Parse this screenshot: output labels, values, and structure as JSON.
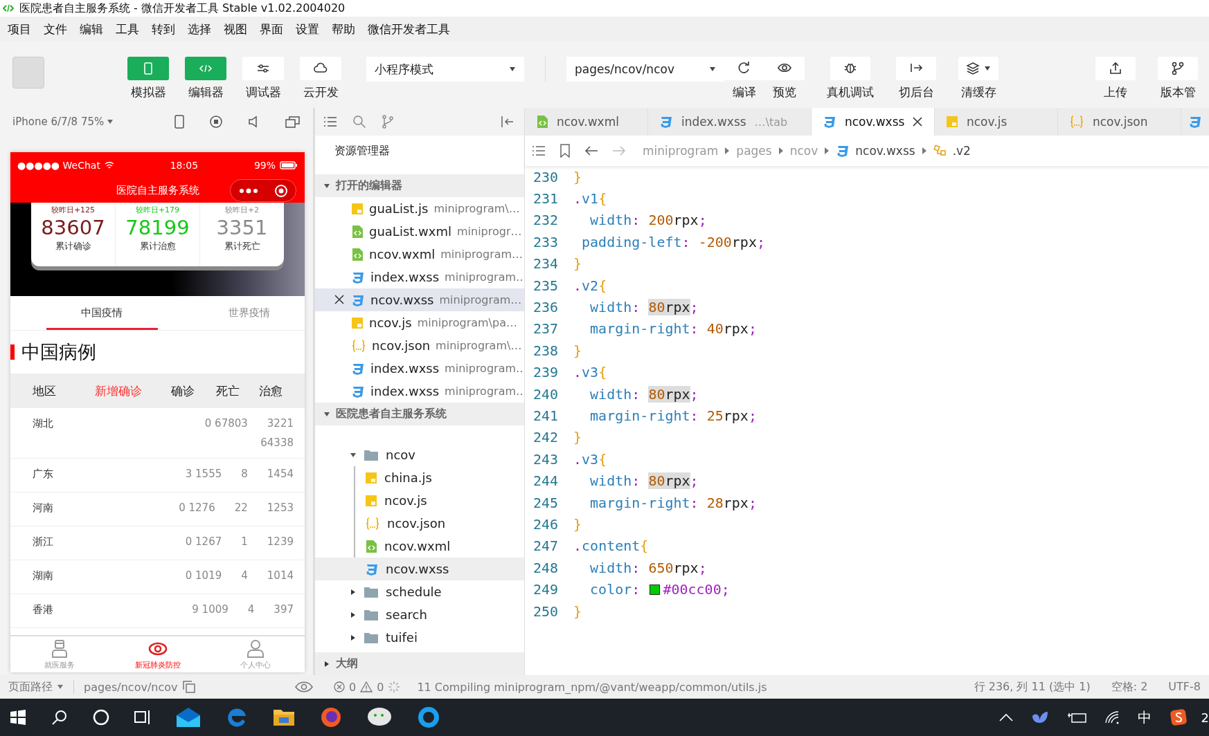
{
  "window": {
    "title": "医院患者自主服务系统 - 微信开发者工具 Stable v1.02.2004020"
  },
  "menu": [
    "项目",
    "文件",
    "编辑",
    "工具",
    "转到",
    "选择",
    "视图",
    "界面",
    "设置",
    "帮助",
    "微信开发者工具"
  ],
  "toolbar": {
    "mode_buttons": [
      {
        "label": "模拟器",
        "on": true
      },
      {
        "label": "编辑器",
        "on": true
      },
      {
        "label": "调试器",
        "on": false
      },
      {
        "label": "云开发",
        "on": false
      }
    ],
    "mode_select": "小程序模式",
    "page_select": "pages/ncov/ncov",
    "actions": [
      "编译",
      "预览",
      "真机调试",
      "切后台",
      "清缓存",
      "上传",
      "版本管"
    ]
  },
  "simulator": {
    "device": "iPhone 6/7/8 75%",
    "phone": {
      "carrier": "●●●●● WeChat",
      "time": "18:05",
      "battery": "99%",
      "nav_title": "医院自主服务系统",
      "stats": [
        {
          "delta": "较昨日+125",
          "value": "83607",
          "label": "累计确诊",
          "color": "#7a1a1a"
        },
        {
          "delta": "较昨日+179",
          "value": "78199",
          "label": "累计治愈",
          "color": "#16c816"
        },
        {
          "delta": "较昨日+2",
          "value": "3351",
          "label": "累计死亡",
          "color": "#8a8a8a"
        }
      ],
      "tabs": [
        {
          "label": "中国疫情",
          "selected": true
        },
        {
          "label": "世界疫情",
          "selected": false
        }
      ],
      "section_title": "中国病例",
      "columns": [
        {
          "label": "地区",
          "highlighted": false
        },
        {
          "label": "新增确诊",
          "highlighted": true
        },
        {
          "label": "确诊",
          "highlighted": false
        },
        {
          "label": "死亡",
          "highlighted": false
        },
        {
          "label": "治愈",
          "highlighted": false
        }
      ],
      "rows": [
        {
          "region": "湖北",
          "values": [
            "0 67803",
            "3221",
            "64338"
          ]
        },
        {
          "region": "广东",
          "values": [
            "3 1555",
            "8",
            "1454"
          ]
        },
        {
          "region": "河南",
          "values": [
            "0 1276",
            "22",
            "1253"
          ]
        },
        {
          "region": "浙江",
          "values": [
            "0 1267",
            "1",
            "1239"
          ]
        },
        {
          "region": "湖南",
          "values": [
            "0 1019",
            "4",
            "1014"
          ]
        },
        {
          "region": "香港",
          "values": [
            "9 1009",
            "4",
            "397"
          ]
        }
      ],
      "bottom_tabs": [
        {
          "label": "就医服务",
          "selected": false
        },
        {
          "label": "新冠肺炎防控",
          "selected": true
        },
        {
          "label": "个人中心",
          "selected": false
        }
      ]
    }
  },
  "explorer": {
    "title": "资源管理器",
    "open_editors": {
      "label": "打开的编辑器",
      "expanded": true,
      "items": [
        {
          "name": "guaList.js",
          "path": "miniprogram\\…",
          "kind": "js",
          "selected": false
        },
        {
          "name": "guaList.wxml",
          "path": "miniprogr…",
          "kind": "wxml",
          "selected": false
        },
        {
          "name": "ncov.wxml",
          "path": "miniprogram…",
          "kind": "wxml",
          "selected": false
        },
        {
          "name": "index.wxss",
          "path": "miniprogram…",
          "kind": "wxss",
          "selected": false
        },
        {
          "name": "ncov.wxss",
          "path": "miniprogram…",
          "kind": "wxss",
          "selected": true
        },
        {
          "name": "ncov.js",
          "path": "miniprogram\\pa…",
          "kind": "js",
          "selected": false
        },
        {
          "name": "ncov.json",
          "path": "miniprogram\\…",
          "kind": "json",
          "selected": false
        },
        {
          "name": "index.wxss",
          "path": "miniprogram…",
          "kind": "wxss",
          "selected": false
        },
        {
          "name": "index.wxss",
          "path": "miniprogram…",
          "kind": "wxss",
          "selected": false
        }
      ]
    },
    "project": {
      "label": "医院患者自主服务系统",
      "expanded": true,
      "tree": [
        {
          "name": "ncov",
          "kind": "folder",
          "expanded": true,
          "selected": false,
          "children": [
            {
              "name": "china.js",
              "kind": "js",
              "selected": false
            },
            {
              "name": "ncov.js",
              "kind": "js",
              "selected": false
            },
            {
              "name": "ncov.json",
              "kind": "json",
              "selected": false
            },
            {
              "name": "ncov.wxml",
              "kind": "wxml",
              "selected": false
            },
            {
              "name": "ncov.wxss",
              "kind": "wxss",
              "selected": true
            }
          ]
        },
        {
          "name": "schedule",
          "kind": "folder",
          "expanded": false,
          "selected": false
        },
        {
          "name": "search",
          "kind": "folder",
          "expanded": false,
          "selected": false
        },
        {
          "name": "tuifei",
          "kind": "folder",
          "expanded": false,
          "selected": false
        }
      ]
    },
    "outline": {
      "label": "大纲",
      "expanded": false
    }
  },
  "editor": {
    "tabs": [
      {
        "name": "ncov.wxml",
        "kind": "wxml",
        "selected": false
      },
      {
        "name": "index.wxss",
        "hint": "…\\tab",
        "kind": "wxss",
        "selected": false
      },
      {
        "name": "ncov.wxss",
        "kind": "wxss",
        "selected": true
      },
      {
        "name": "ncov.js",
        "kind": "js",
        "selected": false
      },
      {
        "name": "ncov.json",
        "kind": "json",
        "selected": false
      }
    ],
    "breadcrumb": [
      {
        "label": "miniprogram",
        "kind": "folder"
      },
      {
        "label": "pages",
        "kind": "folder"
      },
      {
        "label": "ncov",
        "kind": "folder"
      },
      {
        "label": "ncov.wxss",
        "kind": "wxss"
      },
      {
        "label": ".v2",
        "kind": "symbol"
      }
    ],
    "lines": [
      {
        "number": "230",
        "tokens": [
          {
            "text": "}",
            "kind": "brace"
          }
        ]
      },
      {
        "number": "231",
        "tokens": [
          {
            "text": ".",
            "kind": "dot"
          },
          {
            "text": "v1",
            "kind": "sel"
          },
          {
            "text": "{",
            "kind": "brace"
          }
        ]
      },
      {
        "number": "232",
        "tokens": [
          {
            "text": "  width",
            "kind": "prop"
          },
          {
            "text": ": ",
            "kind": "punct"
          },
          {
            "text": "200",
            "kind": "num"
          },
          {
            "text": "rpx",
            "kind": "unit"
          },
          {
            "text": ";",
            "kind": "punct"
          }
        ]
      },
      {
        "number": "233",
        "tokens": [
          {
            "text": " padding-left",
            "kind": "prop"
          },
          {
            "text": ": ",
            "kind": "punct"
          },
          {
            "text": "-200",
            "kind": "num"
          },
          {
            "text": "rpx",
            "kind": "unit"
          },
          {
            "text": ";",
            "kind": "punct"
          }
        ]
      },
      {
        "number": "234",
        "tokens": [
          {
            "text": "}",
            "kind": "brace"
          }
        ]
      },
      {
        "number": "235",
        "tokens": [
          {
            "text": ".",
            "kind": "dot"
          },
          {
            "text": "v2",
            "kind": "sel"
          },
          {
            "text": "{",
            "kind": "brace"
          }
        ]
      },
      {
        "number": "236",
        "tokens": [
          {
            "text": "  width",
            "kind": "prop"
          },
          {
            "text": ": ",
            "kind": "punct"
          },
          {
            "text": "80",
            "kind": "match"
          },
          {
            "text": "rpx",
            "kind": "match-unit"
          },
          {
            "text": ";",
            "kind": "punct"
          }
        ]
      },
      {
        "number": "237",
        "tokens": [
          {
            "text": "  margin-right",
            "kind": "prop"
          },
          {
            "text": ": ",
            "kind": "punct"
          },
          {
            "text": "40",
            "kind": "num"
          },
          {
            "text": "rpx",
            "kind": "unit"
          },
          {
            "text": ";",
            "kind": "punct"
          }
        ]
      },
      {
        "number": "238",
        "tokens": [
          {
            "text": "}",
            "kind": "brace"
          }
        ]
      },
      {
        "number": "239",
        "tokens": [
          {
            "text": ".",
            "kind": "dot"
          },
          {
            "text": "v3",
            "kind": "sel"
          },
          {
            "text": "{",
            "kind": "brace"
          }
        ]
      },
      {
        "number": "240",
        "tokens": [
          {
            "text": "  width",
            "kind": "prop"
          },
          {
            "text": ": ",
            "kind": "punct"
          },
          {
            "text": "80",
            "kind": "match"
          },
          {
            "text": "rpx",
            "kind": "match-unit"
          },
          {
            "text": ";",
            "kind": "punct"
          }
        ]
      },
      {
        "number": "241",
        "tokens": [
          {
            "text": "  margin-right",
            "kind": "prop"
          },
          {
            "text": ": ",
            "kind": "punct"
          },
          {
            "text": "25",
            "kind": "num"
          },
          {
            "text": "rpx",
            "kind": "unit"
          },
          {
            "text": ";",
            "kind": "punct"
          }
        ]
      },
      {
        "number": "242",
        "tokens": [
          {
            "text": "}",
            "kind": "brace"
          }
        ]
      },
      {
        "number": "243",
        "tokens": [
          {
            "text": ".",
            "kind": "dot"
          },
          {
            "text": "v3",
            "kind": "sel"
          },
          {
            "text": "{",
            "kind": "brace"
          }
        ]
      },
      {
        "number": "244",
        "tokens": [
          {
            "text": "  width",
            "kind": "prop"
          },
          {
            "text": ": ",
            "kind": "punct"
          },
          {
            "text": "80",
            "kind": "match"
          },
          {
            "text": "rpx",
            "kind": "match-unit"
          },
          {
            "text": ";",
            "kind": "punct"
          }
        ]
      },
      {
        "number": "245",
        "tokens": [
          {
            "text": "  margin-right",
            "kind": "prop"
          },
          {
            "text": ": ",
            "kind": "punct"
          },
          {
            "text": "28",
            "kind": "num"
          },
          {
            "text": "rpx",
            "kind": "unit"
          },
          {
            "text": ";",
            "kind": "punct"
          }
        ]
      },
      {
        "number": "246",
        "tokens": [
          {
            "text": "}",
            "kind": "brace"
          }
        ]
      },
      {
        "number": "247",
        "tokens": [
          {
            "text": ".",
            "kind": "dot"
          },
          {
            "text": "content",
            "kind": "sel"
          },
          {
            "text": "{",
            "kind": "brace"
          }
        ]
      },
      {
        "number": "248",
        "tokens": [
          {
            "text": "  width",
            "kind": "prop"
          },
          {
            "text": ": ",
            "kind": "punct"
          },
          {
            "text": "650",
            "kind": "num"
          },
          {
            "text": "rpx",
            "kind": "unit"
          },
          {
            "text": ";",
            "kind": "punct"
          }
        ]
      },
      {
        "number": "249",
        "tokens": [
          {
            "text": "  color",
            "kind": "prop"
          },
          {
            "text": ": ",
            "kind": "punct"
          },
          {
            "kind": "swatch",
            "color": "#00cc00"
          },
          {
            "text": "#00cc00",
            "kind": "hex"
          },
          {
            "text": ";",
            "kind": "punct"
          }
        ]
      },
      {
        "number": "250",
        "tokens": [
          {
            "text": "}",
            "kind": "brace"
          }
        ]
      }
    ]
  },
  "status_bar": {
    "page_path_label": "页面路径",
    "page_path": "pages/ncov/ncov",
    "errors": "0",
    "warnings": "0",
    "message": "11 Compiling miniprogram_npm/@vant/weapp/common/utils.js",
    "position": "行 236, 列 11 (选中 1)",
    "indent": "空格: 2",
    "encoding": "UTF-8"
  },
  "taskbar": {
    "input_method": "中",
    "clock": "2"
  }
}
